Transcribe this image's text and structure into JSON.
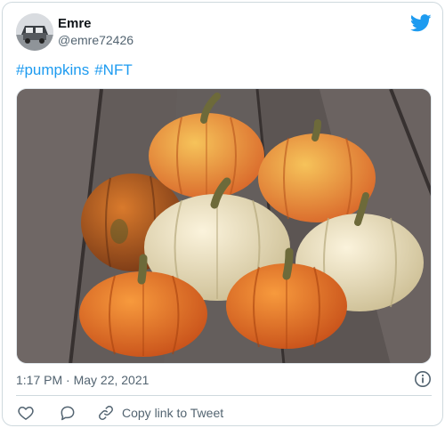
{
  "tweet": {
    "author_name": "Emre",
    "author_handle": "@emre72426",
    "hashtags": [
      "#pumpkins",
      "#NFT"
    ],
    "photo_description_icon": "pumpkins-photo",
    "timestamp": "1:17 PM · May 22, 2021",
    "actions": {
      "like_icon": "heart-icon",
      "reply_icon": "speech-bubble-icon",
      "copy_link_icon": "link-icon",
      "copy_link_label": "Copy link to Tweet"
    }
  },
  "colors": {
    "link": "#1d9bf0",
    "secondary_text": "#536471",
    "border": "#cfd9de",
    "brand": "#1d9bf0"
  }
}
